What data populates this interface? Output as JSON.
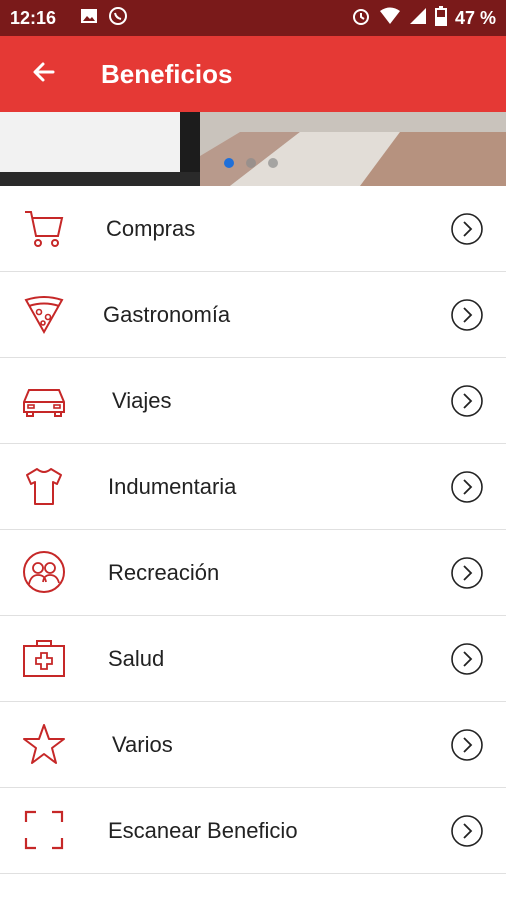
{
  "status": {
    "time": "12:16",
    "battery": "47 %"
  },
  "appbar": {
    "title": "Beneficios"
  },
  "carousel": {
    "active_index": 0,
    "count": 3
  },
  "menu": [
    {
      "label": "Compras",
      "icon": "cart-icon"
    },
    {
      "label": "Gastronomía",
      "icon": "pizza-icon"
    },
    {
      "label": "Viajes",
      "icon": "car-icon"
    },
    {
      "label": "Indumentaria",
      "icon": "shirt-icon"
    },
    {
      "label": "Recreación",
      "icon": "people-icon"
    },
    {
      "label": "Salud",
      "icon": "medkit-icon"
    },
    {
      "label": "Varios",
      "icon": "star-icon"
    },
    {
      "label": "Escanear Beneficio",
      "icon": "scan-icon"
    }
  ],
  "colors": {
    "accent": "#e53935",
    "statusbar": "#7a1a1a",
    "icon": "#c62828"
  }
}
